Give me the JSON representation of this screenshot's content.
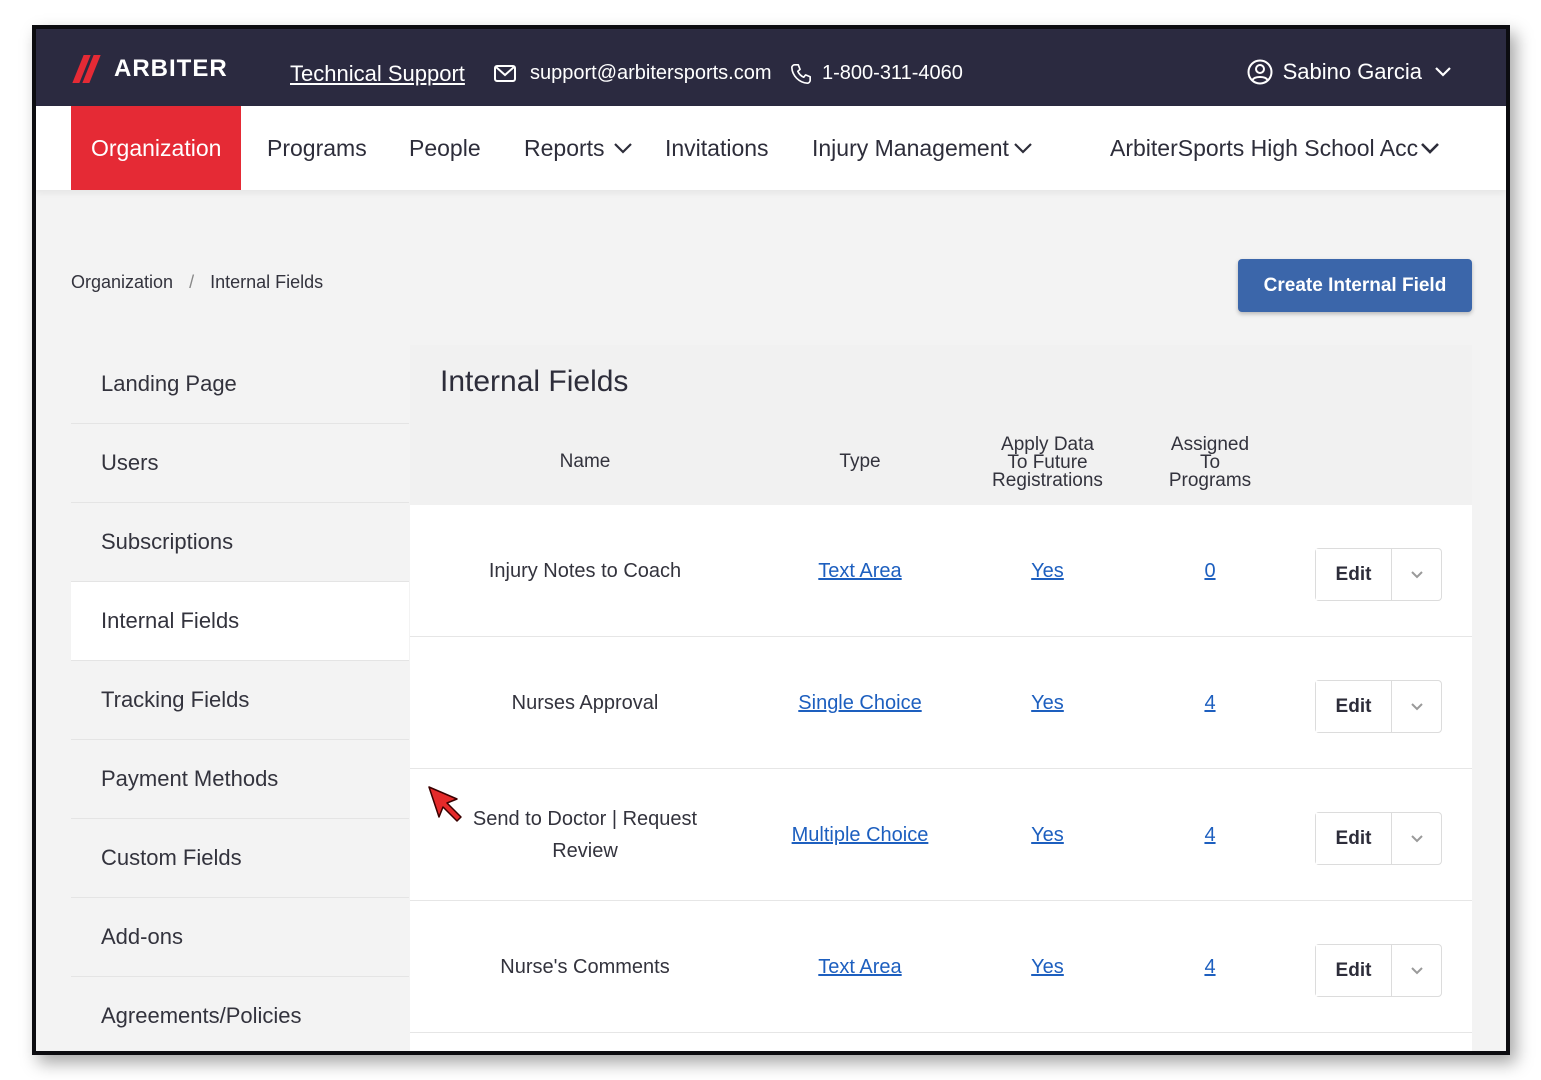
{
  "brand": {
    "logo_text": "ARBITER",
    "accent_color": "#e52a35",
    "header_color": "#2b2a40"
  },
  "topbar": {
    "support_link": "Technical Support",
    "support_email": "support@arbitersports.com",
    "support_phone": "1-800-311-4060",
    "user_name": "Sabino Garcia"
  },
  "nav": {
    "items": [
      {
        "label": "Organization",
        "active": true
      },
      {
        "label": "Programs"
      },
      {
        "label": "People"
      },
      {
        "label": "Reports",
        "has_dropdown": true
      },
      {
        "label": "Invitations"
      },
      {
        "label": "Injury Management",
        "has_dropdown": true
      },
      {
        "label": "ArbiterSports High School Acc",
        "has_dropdown": true
      }
    ]
  },
  "breadcrumb": {
    "parent": "Organization",
    "separator": "/",
    "current": "Internal Fields"
  },
  "actions": {
    "create_label": "Create Internal Field",
    "button_color": "#3b66aa"
  },
  "sidebar": {
    "items": [
      {
        "label": "Landing Page"
      },
      {
        "label": "Users"
      },
      {
        "label": "Subscriptions"
      },
      {
        "label": "Internal Fields",
        "active": true
      },
      {
        "label": "Tracking Fields"
      },
      {
        "label": "Payment Methods"
      },
      {
        "label": "Custom Fields"
      },
      {
        "label": "Add-ons"
      },
      {
        "label": "Agreements/Policies"
      }
    ]
  },
  "table": {
    "title": "Internal Fields",
    "headers": {
      "name": "Name",
      "type": "Type",
      "apply_line1": "Apply Data",
      "apply_line2": "To Future",
      "apply_line3": "Registrations",
      "assigned_line1": "Assigned",
      "assigned_line2": "To",
      "assigned_line3": "Programs"
    },
    "edit_label": "Edit",
    "rows": [
      {
        "name": "Injury Notes to Coach",
        "type": "Text Area",
        "apply": "Yes",
        "assigned": "0"
      },
      {
        "name": "Nurses Approval",
        "type": "Single Choice",
        "apply": "Yes",
        "assigned": "4"
      },
      {
        "name": "Send to Doctor | Request Review",
        "type": "Multiple Choice",
        "apply": "Yes",
        "assigned": "4"
      },
      {
        "name": "Nurse's Comments",
        "type": "Text Area",
        "apply": "Yes",
        "assigned": "4"
      }
    ]
  },
  "link_color": "#1d5fbf"
}
